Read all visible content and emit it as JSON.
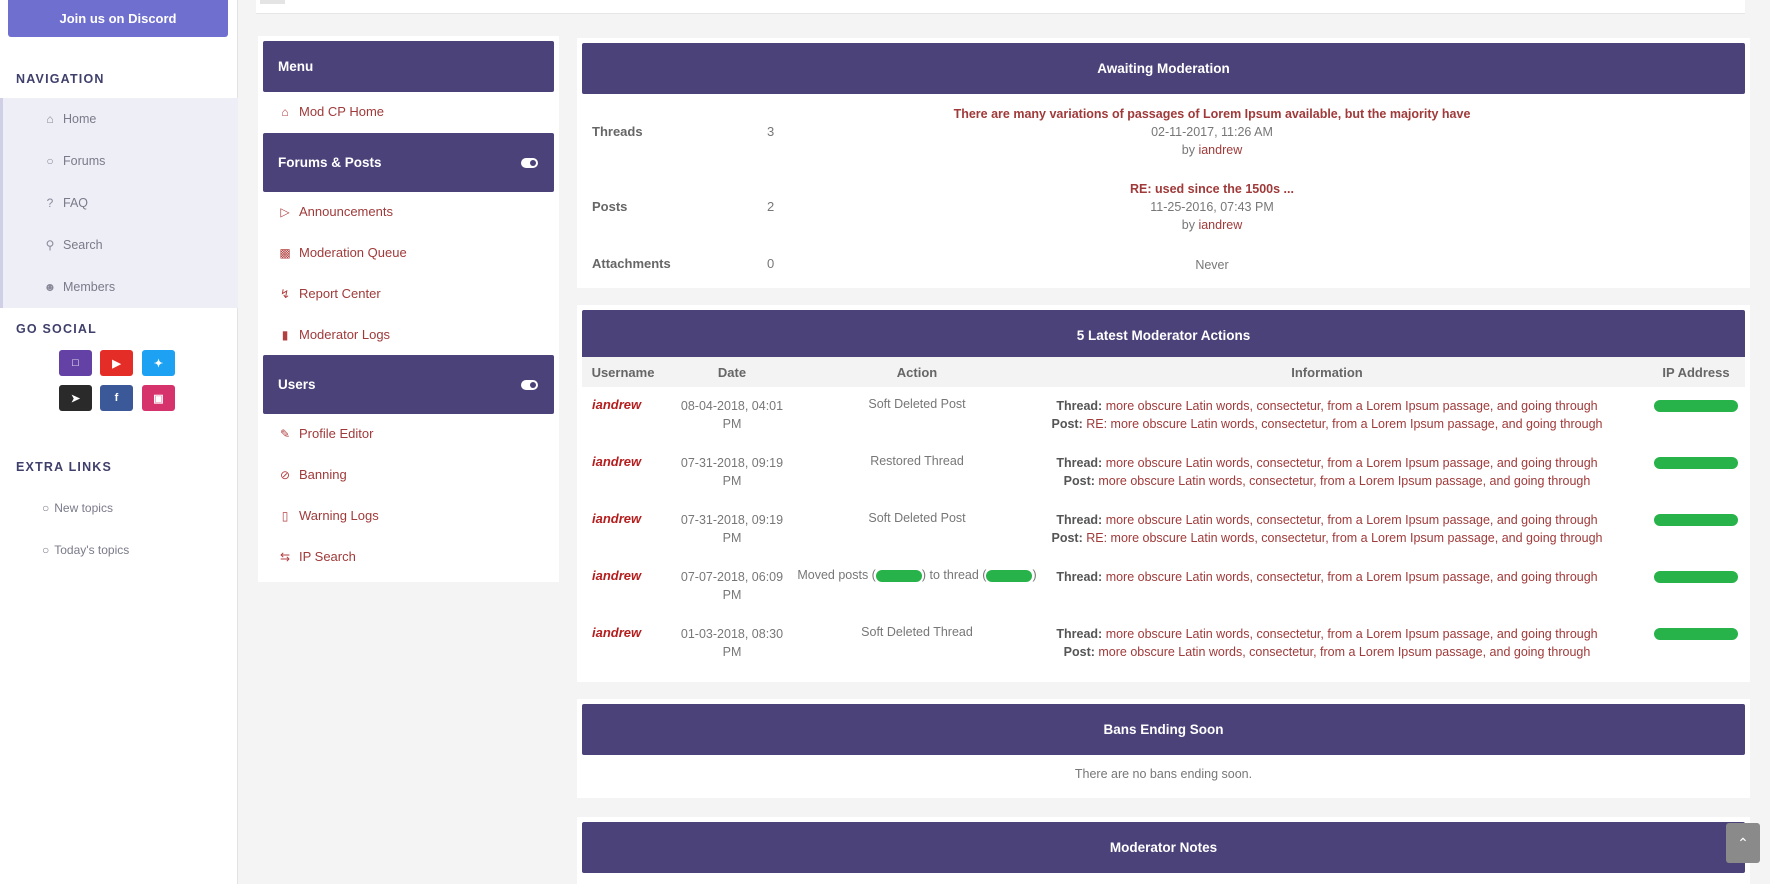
{
  "sidebar": {
    "discord_label": "Join us on Discord",
    "navigation_heading": "NAVIGATION",
    "nav_items": [
      {
        "label": "Home",
        "icon": "home-icon"
      },
      {
        "label": "Forums",
        "icon": "comment-icon"
      },
      {
        "label": "FAQ",
        "icon": "question-icon"
      },
      {
        "label": "Search",
        "icon": "search-icon"
      },
      {
        "label": "Members",
        "icon": "user-circle-icon"
      }
    ],
    "social_heading": "GO SOCIAL",
    "social": [
      {
        "name": "twitch",
        "color": "#6441a5"
      },
      {
        "name": "youtube",
        "color": "#e52d27"
      },
      {
        "name": "twitter",
        "color": "#1da1f2"
      },
      {
        "name": "steam",
        "color": "#2a2a2a"
      },
      {
        "name": "facebook",
        "color": "#3b5998"
      },
      {
        "name": "instagram",
        "color": "#d6336c"
      }
    ],
    "extra_heading": "EXTRA LINKS",
    "extra_items": [
      {
        "label": "New topics"
      },
      {
        "label": "Today's topics"
      }
    ]
  },
  "menu": {
    "header": "Menu",
    "home_label": "Mod CP Home",
    "forums_header": "Forums & Posts",
    "forums_items": [
      {
        "label": "Announcements",
        "icon": "bullhorn-icon"
      },
      {
        "label": "Moderation Queue",
        "icon": "archive-icon"
      },
      {
        "label": "Report Center",
        "icon": "bolt-icon"
      },
      {
        "label": "Moderator Logs",
        "icon": "file-icon"
      }
    ],
    "users_header": "Users",
    "users_items": [
      {
        "label": "Profile Editor",
        "icon": "edit-icon"
      },
      {
        "label": "Banning",
        "icon": "ban-icon"
      },
      {
        "label": "Warning Logs",
        "icon": "file-outline-icon"
      },
      {
        "label": "IP Search",
        "icon": "retweet-icon"
      }
    ]
  },
  "awaiting": {
    "title": "Awaiting Moderation",
    "rows": [
      {
        "label": "Threads",
        "count": "3",
        "item_title": "There are many variations of passages of Lorem Ipsum available, but the majority have",
        "date": "02-11-2017, 11:26 AM",
        "by": "by",
        "user": "iandrew"
      },
      {
        "label": "Posts",
        "count": "2",
        "item_title": "RE: used since the 1500s ...",
        "date": "11-25-2016, 07:43 PM",
        "by": "by",
        "user": "iandrew"
      },
      {
        "label": "Attachments",
        "count": "0",
        "never": "Never"
      }
    ]
  },
  "actions": {
    "title": "5 Latest Moderator Actions",
    "columns": [
      "Username",
      "Date",
      "Action",
      "Information",
      "IP Address"
    ],
    "rows": [
      {
        "user": "iandrew",
        "date": "08-04-2018, 04:01 PM",
        "action": "Soft Deleted Post",
        "thread_label": "Thread:",
        "thread": "more obscure Latin words, consectetur, from a Lorem Ipsum passage, and going through",
        "post_label": "Post:",
        "post": "RE: more obscure Latin words, consectetur, from a Lorem Ipsum passage, and going through"
      },
      {
        "user": "iandrew",
        "date": "07-31-2018, 09:19 PM",
        "action": "Restored Thread",
        "thread_label": "Thread:",
        "thread": "more obscure Latin words, consectetur, from a Lorem Ipsum passage, and going through",
        "post_label": "Post:",
        "post": "more obscure Latin words, consectetur, from a Lorem Ipsum passage, and going through"
      },
      {
        "user": "iandrew",
        "date": "07-31-2018, 09:19 PM",
        "action": "Soft Deleted Post",
        "thread_label": "Thread:",
        "thread": "more obscure Latin words, consectetur, from a Lorem Ipsum passage, and going through",
        "post_label": "Post:",
        "post": "RE: more obscure Latin words, consectetur, from a Lorem Ipsum passage, and going through"
      },
      {
        "user": "iandrew",
        "date": "07-07-2018, 06:09 PM",
        "action_pre": "Moved posts (",
        "action_mid": ") to thread (",
        "action_post": ")",
        "thread_label": "Thread:",
        "thread": "more obscure Latin words, consectetur, from a Lorem Ipsum passage, and going through"
      },
      {
        "user": "iandrew",
        "date": "01-03-2018, 08:30 PM",
        "action": "Soft Deleted Thread",
        "thread_label": "Thread:",
        "thread": "more obscure Latin words, consectetur, from a Lorem Ipsum passage, and going through",
        "post_label": "Post:",
        "post": "more obscure Latin words, consectetur, from a Lorem Ipsum passage, and going through"
      }
    ]
  },
  "bans": {
    "title": "Bans Ending Soon",
    "empty": "There are no bans ending soon."
  },
  "notes": {
    "title": "Moderator Notes"
  },
  "colors": {
    "header_bg": "#4b4279",
    "link": "#a03a3a",
    "username": "#b51e1e",
    "redaction": "#27b34a"
  }
}
